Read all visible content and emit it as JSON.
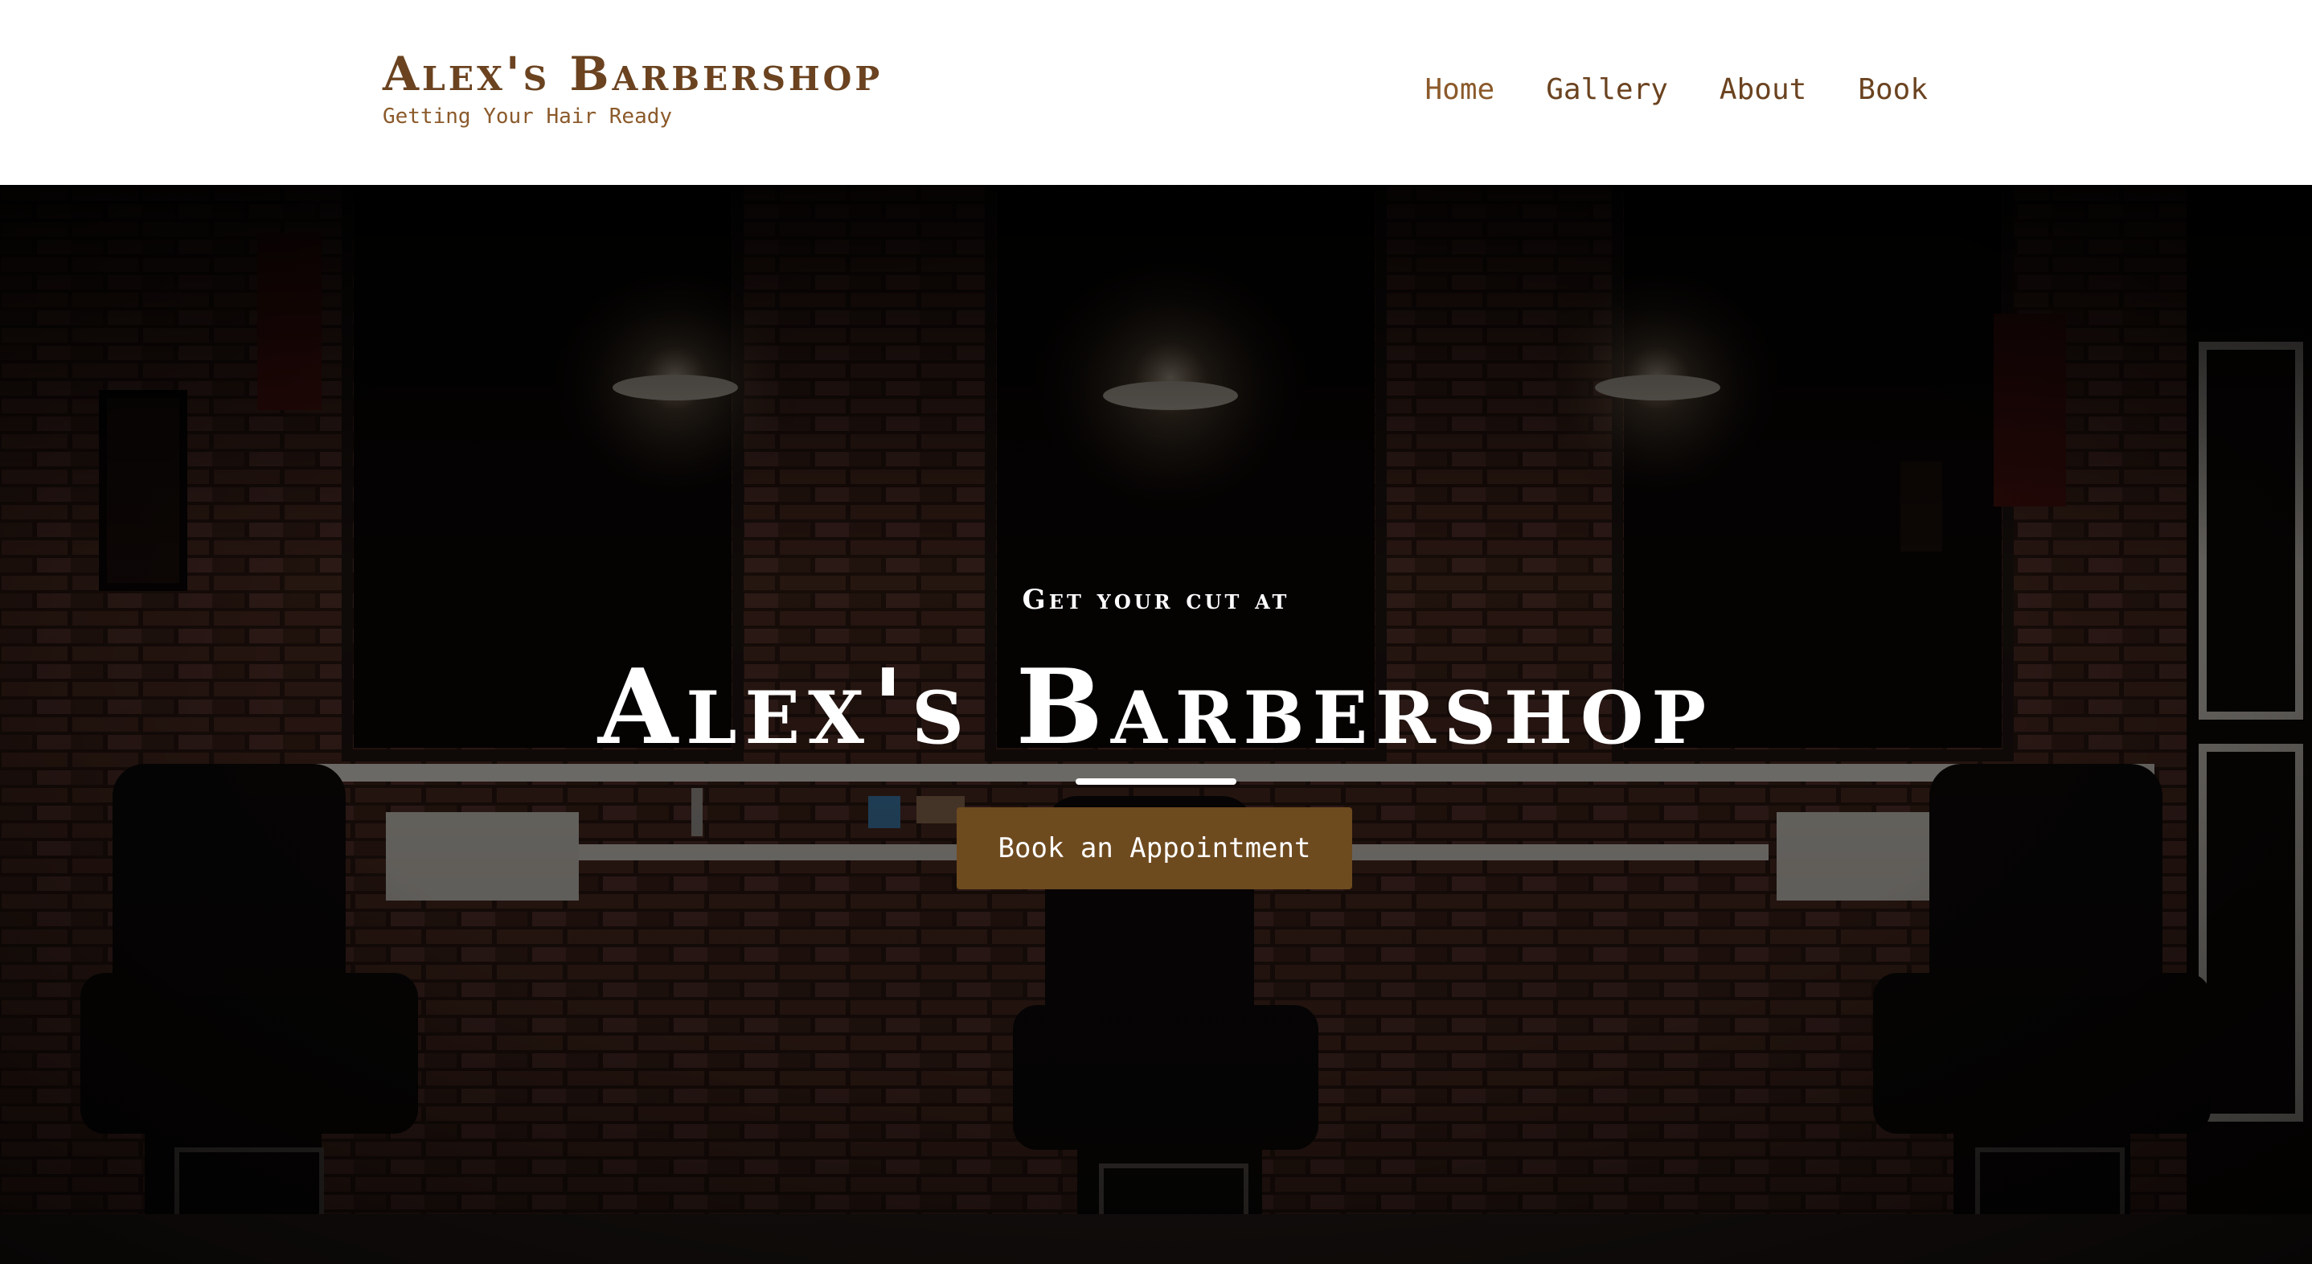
{
  "header": {
    "brand_title": "Alex's Barbershop",
    "brand_tagline": "Getting Your Hair Ready",
    "nav": [
      {
        "label": "Home",
        "active": true
      },
      {
        "label": "Gallery",
        "active": false
      },
      {
        "label": "About",
        "active": false
      },
      {
        "label": "Book",
        "active": false
      }
    ]
  },
  "hero": {
    "subtitle": "Get your cut at",
    "title": "Alex's Barbershop",
    "cta_label": "Book an Appointment"
  },
  "colors": {
    "brand_brown": "#6b4320",
    "nav_active": "#8b5a2b",
    "cta_background": "#6e4a1f",
    "header_background": "#ffffff",
    "hero_text": "#ffffff"
  }
}
